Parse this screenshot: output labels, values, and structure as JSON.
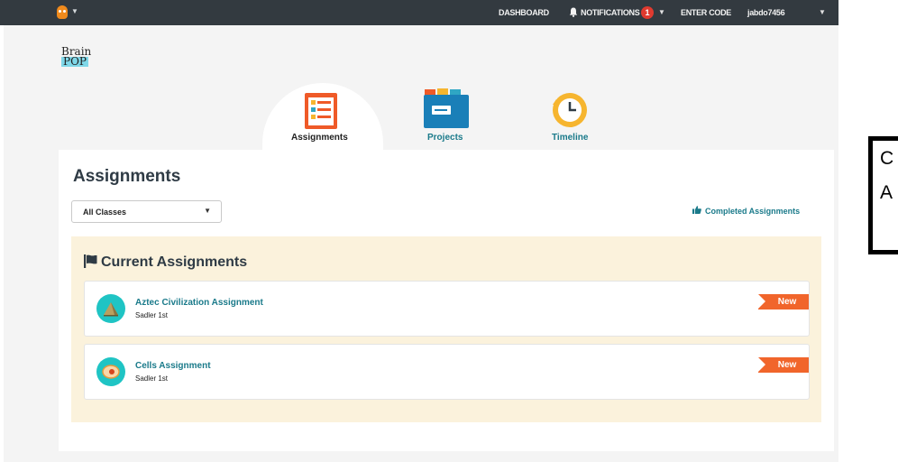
{
  "topnav": {
    "dashboard": "DASHBOARD",
    "notifications": "NOTIFICATIONS",
    "notification_count": "1",
    "enter_code": "ENTER CODE",
    "username": "jabdo7456"
  },
  "logo": {
    "line1": "Brain",
    "line2": "POP"
  },
  "tabs": [
    {
      "label": "Assignments",
      "active": true
    },
    {
      "label": "Projects",
      "active": false
    },
    {
      "label": "Timeline",
      "active": false
    }
  ],
  "page_title": "Assignments",
  "class_filter": {
    "selected": "All Classes"
  },
  "completed_link": "Completed Assignments",
  "section_title": "Current Assignments",
  "assignments": [
    {
      "title": "Aztec Civilization Assignment",
      "class": "Sadler 1st",
      "tag": "New"
    },
    {
      "title": "Cells Assignment",
      "class": "Sadler 1st",
      "tag": "New"
    }
  ],
  "callout": {
    "line1": "C",
    "line2": "A"
  },
  "colors": {
    "accent": "#1a7a8a",
    "new_tag": "#f1652b",
    "topbar": "#333a40",
    "panel": "#fbf2dc"
  }
}
